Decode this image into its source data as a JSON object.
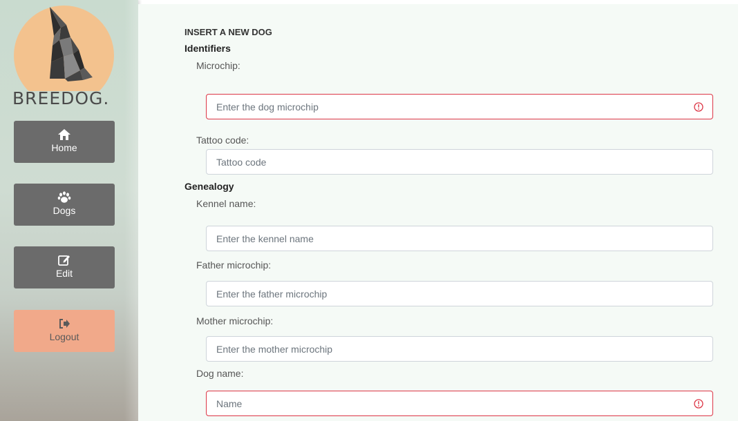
{
  "brand": {
    "name": "BREEDOG."
  },
  "nav": {
    "home": "Home",
    "dogs": "Dogs",
    "edit": "Edit",
    "logout": "Logout"
  },
  "form": {
    "title": "INSERT A NEW DOG",
    "sections": {
      "identifiers": "Identifiers",
      "genealogy": "Genealogy"
    },
    "fields": {
      "microchip": {
        "label": "Microchip:",
        "placeholder": "Enter the dog microchip",
        "value": ""
      },
      "tattoo": {
        "label": "Tattoo code:",
        "placeholder": "Tattoo code",
        "value": ""
      },
      "kennel": {
        "label": "Kennel name:",
        "placeholder": "Enter the kennel name",
        "value": ""
      },
      "father": {
        "label": "Father microchip:",
        "placeholder": "Enter the father microchip",
        "value": ""
      },
      "mother": {
        "label": "Mother microchip:",
        "placeholder": "Enter the mother microchip",
        "value": ""
      },
      "dogname": {
        "label": "Dog name:",
        "placeholder": "Name",
        "value": ""
      }
    }
  },
  "colors": {
    "sidebar_button": "#6b6b6b",
    "logout_button": "#f1a98a",
    "error_border": "#dc3545",
    "logo_sun": "#f3c28e"
  },
  "icons": {
    "home": "home-icon",
    "dogs": "paw-icon",
    "edit": "edit-icon",
    "logout": "sign-out-icon",
    "error": "exclamation-circle-icon"
  }
}
